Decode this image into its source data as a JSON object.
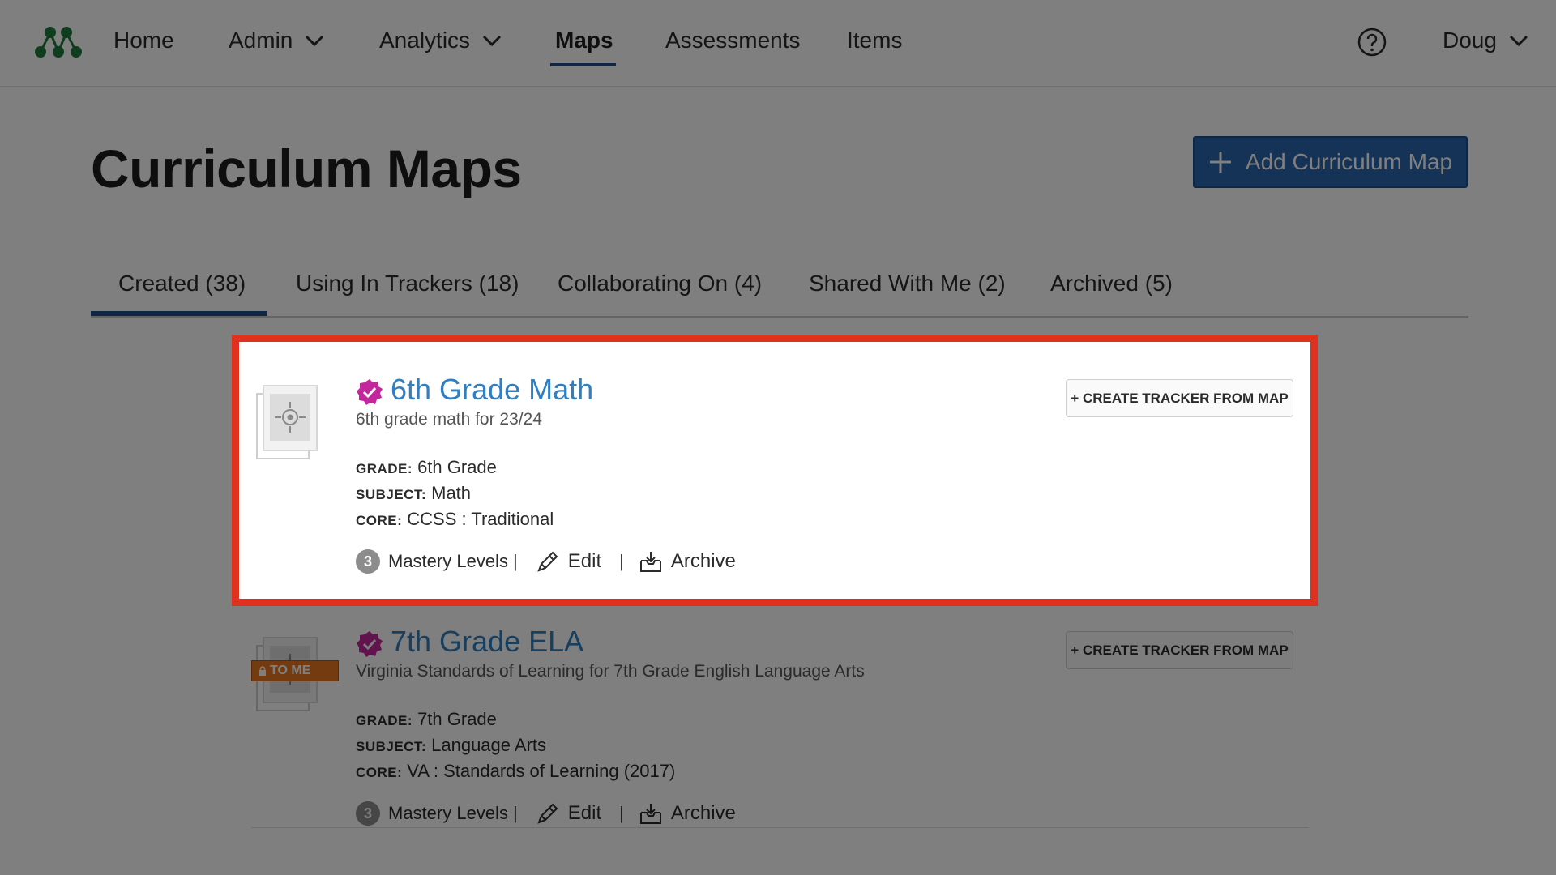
{
  "nav": {
    "items": [
      {
        "label": "Home"
      },
      {
        "label": "Admin"
      },
      {
        "label": "Analytics"
      },
      {
        "label": "Maps"
      },
      {
        "label": "Assessments"
      },
      {
        "label": "Items"
      }
    ],
    "active": "Maps",
    "user": "Doug"
  },
  "header": {
    "title": "Curriculum Maps",
    "add_button": "Add Curriculum Map"
  },
  "tabs": [
    {
      "label": "Created (38)"
    },
    {
      "label": "Using In Trackers (18)"
    },
    {
      "label": "Collaborating On (4)"
    },
    {
      "label": "Shared With Me (2)"
    },
    {
      "label": "Archived (5)"
    }
  ],
  "active_tab": "Created (38)",
  "labels": {
    "grade": "GRADE:",
    "subject": "SUBJECT:",
    "core": "CORE:",
    "mastery": "Mastery Levels |",
    "pipe": "|",
    "edit": "Edit",
    "archive": "Archive",
    "create_tracker": "+ CREATE TRACKER FROM MAP",
    "shared_tag": "TO ME"
  },
  "maps": [
    {
      "title": "6th Grade Math",
      "description": "6th grade math for 23/24",
      "grade": "6th Grade",
      "subject": "Math",
      "core": "CCSS : Traditional",
      "mastery_levels": "3"
    },
    {
      "title": "7th Grade ELA",
      "description": "Virginia Standards of Learning for 7th Grade English Language Arts",
      "grade": "7th Grade",
      "subject": "Language Arts",
      "core": "VA : Standards of Learning (2017)",
      "mastery_levels": "3"
    }
  ],
  "colors": {
    "brand_green": "#1e7a3c",
    "primary_blue": "#2a66ad",
    "link_blue": "#2f7fc1",
    "verified_magenta": "#c2279b",
    "highlight_red": "#e0301e",
    "tag_orange": "#e87722"
  }
}
